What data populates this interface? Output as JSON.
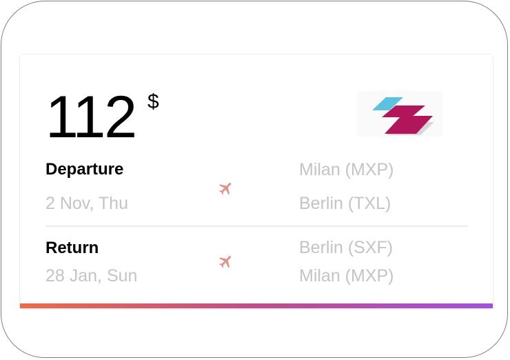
{
  "price": {
    "amount": "112",
    "currency": "$"
  },
  "airline_logo": {
    "icon": "airline-logo-stripes",
    "colors": [
      "#5bc2e0",
      "#b01659",
      "#d8d8d8"
    ]
  },
  "departure": {
    "label": "Departure",
    "date": "2 Nov, Thu",
    "from": "Milan (MXP)",
    "to": "Berlin (TXL)",
    "icon": "plane-icon"
  },
  "return": {
    "label": "Return",
    "date": "28 Jan, Sun",
    "from": "Berlin (SXF)",
    "to": "Milan (MXP)",
    "icon": "plane-icon"
  },
  "colors": {
    "plane_icon": "#e2938d",
    "muted_text": "#c4c4c4",
    "gradient_start": "#f06a45",
    "gradient_mid": "#c24c8a",
    "gradient_end": "#a34fe0"
  }
}
